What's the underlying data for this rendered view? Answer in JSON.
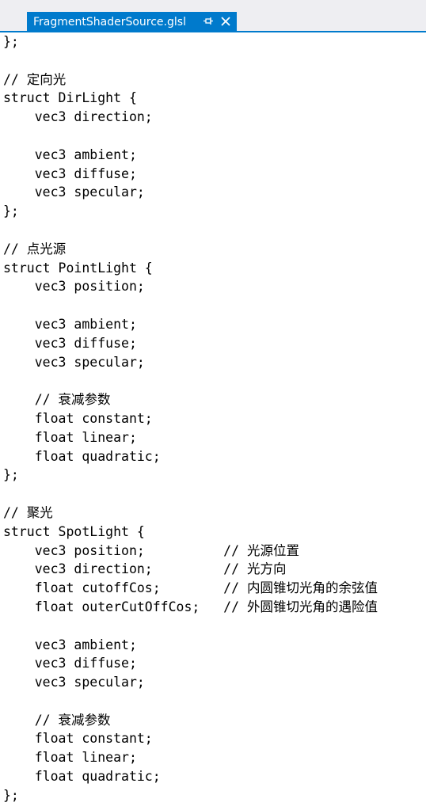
{
  "tab": {
    "title": "FragmentShaderSource.glsl",
    "pin_icon": "pin-icon",
    "close_icon": "close-icon",
    "accent": "#007acc"
  },
  "code_lines": [
    "};",
    "",
    "// 定向光",
    "struct DirLight {",
    "    vec3 direction;",
    "",
    "    vec3 ambient;",
    "    vec3 diffuse;",
    "    vec3 specular;",
    "};",
    "",
    "// 点光源",
    "struct PointLight {",
    "    vec3 position;",
    "",
    "    vec3 ambient;",
    "    vec3 diffuse;",
    "    vec3 specular;",
    "",
    "    // 衰减参数",
    "    float constant;",
    "    float linear;",
    "    float quadratic;",
    "};",
    "",
    "// 聚光",
    "struct SpotLight {",
    "    vec3 position;          // 光源位置",
    "    vec3 direction;         // 光方向",
    "    float cutoffCos;        // 内圆锥切光角的余弦值",
    "    float outerCutOffCos;   // 外圆锥切光角的遇险值",
    "",
    "    vec3 ambient;",
    "    vec3 diffuse;",
    "    vec3 specular;",
    "",
    "    // 衰减参数",
    "    float constant;",
    "    float linear;",
    "    float quadratic;",
    "};"
  ]
}
